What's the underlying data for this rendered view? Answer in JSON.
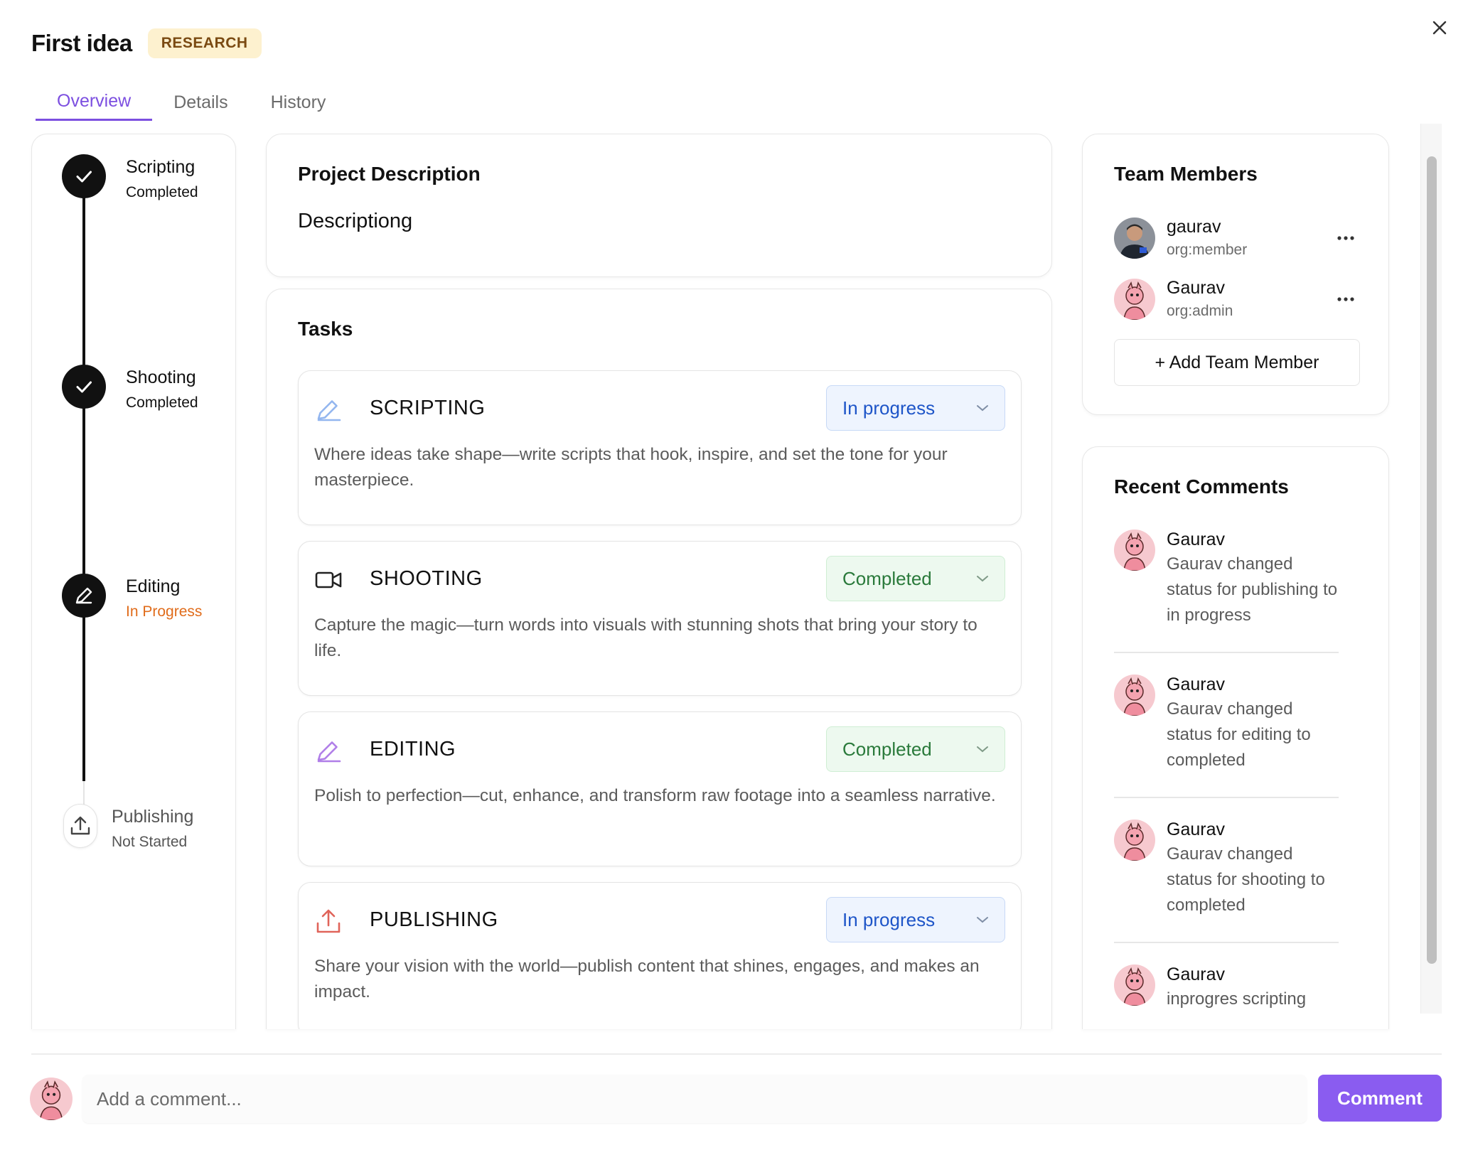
{
  "header": {
    "title": "First idea",
    "badge": "RESEARCH",
    "close_icon": "close-icon"
  },
  "tabs": [
    {
      "label": "Overview",
      "active": true
    },
    {
      "label": "Details",
      "active": false
    },
    {
      "label": "History",
      "active": false
    }
  ],
  "timeline": {
    "steps": [
      {
        "name": "Scripting",
        "status": "Completed",
        "icon": "check-icon"
      },
      {
        "name": "Shooting",
        "status": "Completed",
        "icon": "check-icon"
      },
      {
        "name": "Editing",
        "status": "In Progress",
        "icon": "pencil-icon"
      },
      {
        "name": "Publishing",
        "status": "Not Started",
        "icon": "upload-icon"
      }
    ]
  },
  "project": {
    "title": "Project Description",
    "description": "Descriptiong"
  },
  "tasks": {
    "title": "Tasks",
    "items": [
      {
        "icon": "pencil-icon",
        "title": "SCRIPTING",
        "status": "In progress",
        "status_color": "#1e55c8",
        "description": "Where ideas take shape—write scripts that hook, inspire, and set the tone for your masterpiece."
      },
      {
        "icon": "video-camera-icon",
        "title": "SHOOTING",
        "status": "Completed",
        "status_color": "#2a7a3b",
        "description": "Capture the magic—turn words into visuals with stunning shots that bring your story to life."
      },
      {
        "icon": "pencil-icon",
        "title": "EDITING",
        "status": "Completed",
        "status_color": "#2a7a3b",
        "description": "Polish to perfection—cut, enhance, and transform raw footage into a seamless narrative."
      },
      {
        "icon": "upload-icon",
        "title": "PUBLISHING",
        "status": "In progress",
        "status_color": "#1e55c8",
        "description": "Share your vision with the world—publish content that shines, engages, and makes an impact."
      }
    ]
  },
  "team": {
    "title": "Team Members",
    "members": [
      {
        "name": "gaurav",
        "role": "org:member"
      },
      {
        "name": "Gaurav",
        "role": "org:admin"
      }
    ],
    "add_label": "+ Add Team Member"
  },
  "comments": {
    "title": "Recent Comments",
    "items": [
      {
        "author": "Gaurav",
        "text": "Gaurav changed status for publishing to in progress"
      },
      {
        "author": "Gaurav",
        "text": "Gaurav changed status for editing to completed"
      },
      {
        "author": "Gaurav",
        "text": "Gaurav changed status for shooting to completed"
      },
      {
        "author": "Gaurav",
        "text": "inprogres scripting"
      }
    ]
  },
  "composer": {
    "placeholder": "Add a comment...",
    "button_label": "Comment"
  },
  "colors": {
    "accent": "#7c4fe0",
    "button": "#8a5cf0",
    "in_progress_orange": "#e06c1b"
  }
}
